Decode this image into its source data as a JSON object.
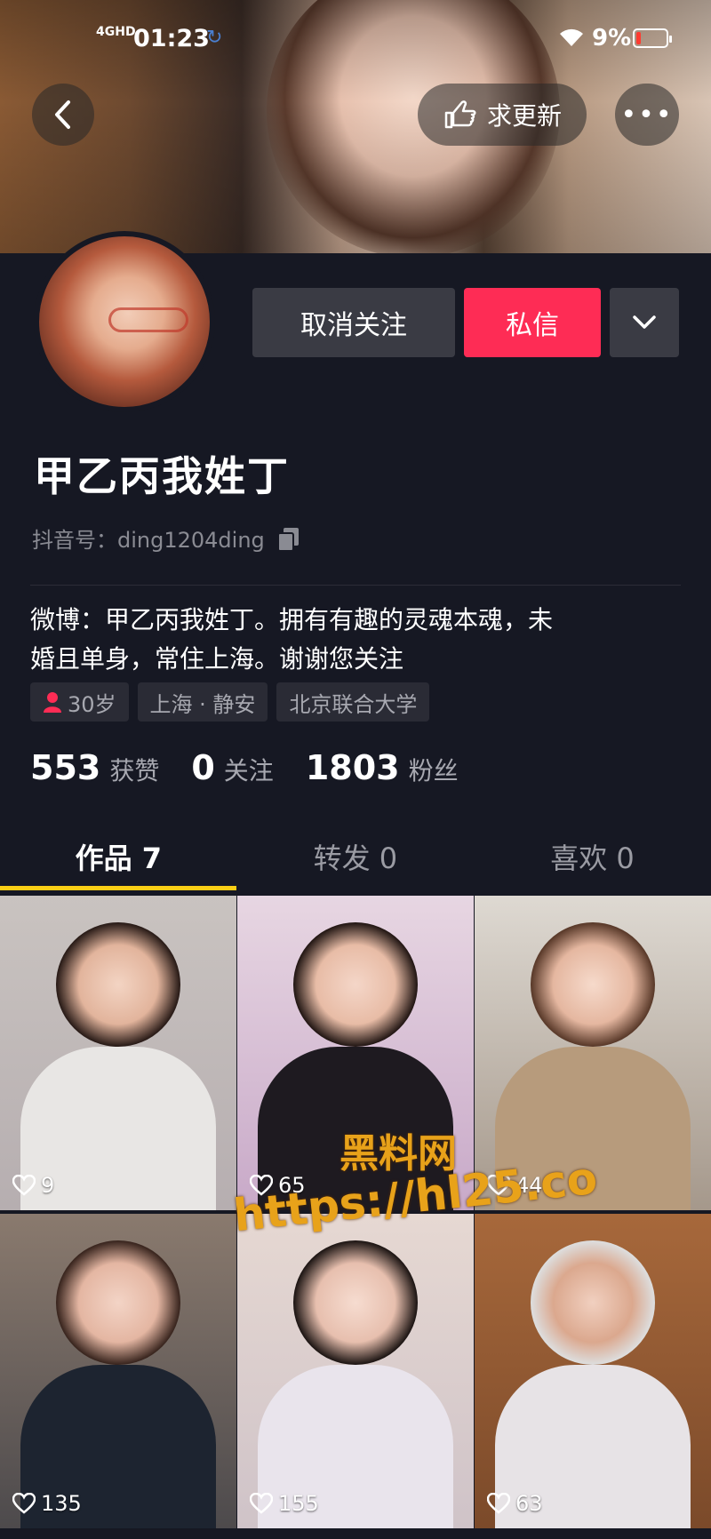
{
  "status": {
    "network": "4GHD",
    "time": "01:23",
    "battery": "9%",
    "battery_color": "#ff3b30"
  },
  "header": {
    "update_label": "求更新",
    "icons": [
      "back-icon",
      "hand-point-icon",
      "more-icon"
    ]
  },
  "profile": {
    "nickname": "甲乙丙我姓丁",
    "douyin_id": "抖音号：ding1204ding",
    "bio_line1": "微博：甲乙丙我姓丁。拥有有趣的灵魂本魂，未",
    "bio_line2": "婚且单身，常住上海。谢谢您关注",
    "tags": {
      "age": "30岁",
      "location": "上海 · 静安",
      "school": "北京联合大学"
    }
  },
  "actions": {
    "unfollow": "取消关注",
    "message": "私信"
  },
  "stats": {
    "likes_num": "553",
    "likes_lbl": "获赞",
    "following_num": "0",
    "following_lbl": "关注",
    "followers_num": "1803",
    "followers_lbl": "粉丝"
  },
  "tabs": {
    "works": "作品 7",
    "reposts": "转发 0",
    "likes": "喜欢 0"
  },
  "videos": [
    {
      "likes": "9"
    },
    {
      "likes": "65"
    },
    {
      "likes": "44"
    },
    {
      "likes": "135"
    },
    {
      "likes": "155"
    },
    {
      "likes": "63"
    }
  ],
  "watermark": {
    "title": "黑料网",
    "url": "https://hl25.co"
  },
  "colors": {
    "accent": "#fe2c55",
    "tab_indicator": "#facE15",
    "background": "#161823"
  }
}
